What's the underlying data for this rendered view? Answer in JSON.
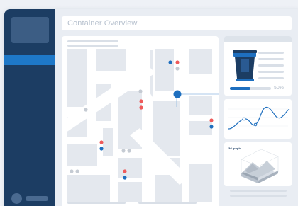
{
  "header": {
    "title": "Container Overview"
  },
  "detail": {
    "fill_level_text": "50%",
    "fill_level": 0.5
  },
  "chart": {
    "label": "3d graph"
  },
  "colors": {
    "sidebar": "#1c3d63",
    "accent": "#1e78c8",
    "status_red": "#ee5a5a",
    "status_blue": "#1e6fbf",
    "status_gray": "#c5cbd3"
  },
  "map_markers": [
    {
      "status": "blue"
    },
    {
      "status": "red"
    },
    {
      "status": "gray"
    },
    {
      "status": "gray"
    },
    {
      "status": "red"
    },
    {
      "status": "red"
    },
    {
      "status": "gray"
    },
    {
      "status": "red"
    },
    {
      "status": "blue"
    },
    {
      "status": "gray"
    },
    {
      "status": "gray"
    },
    {
      "status": "red"
    },
    {
      "status": "blue"
    },
    {
      "status": "gray"
    },
    {
      "status": "gray"
    },
    {
      "status": "red"
    },
    {
      "status": "blue"
    },
    {
      "status": "selected"
    }
  ]
}
